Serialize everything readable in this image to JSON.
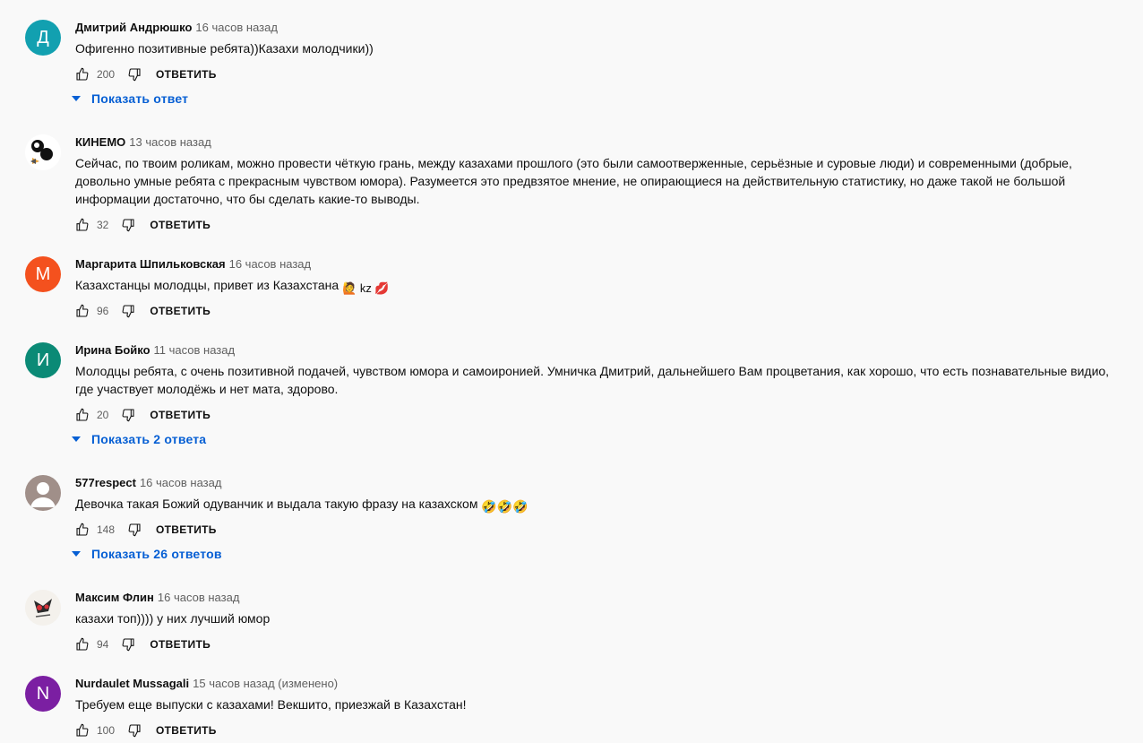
{
  "comments": [
    {
      "avatar_letter": "Д",
      "avatar_color": "#12a0b0",
      "author": "Дмитрий Андрюшко",
      "time": "16 часов назад",
      "text": "Офигенно позитивные ребята))Казахи молодчики))",
      "likes": "200",
      "reply_label": "ОТВЕТИТЬ",
      "replies_label": "Показать ответ"
    },
    {
      "avatar_letter": "",
      "avatar_color": "#ffffff",
      "author": "КИНЕМО",
      "time": "13 часов назад",
      "text": "Сейчас, по твоим роликам, можно провести чёткую грань, между казахами прошлого (это были самоотверженные, серьёзные и суровые люди) и современными (добрые, довольно умные ребята с прекрасным чувством юмора). Разумеется это предвзятое мнение, не опирающиеся на действительную статистику, но даже такой не большой информации достаточно, что бы сделать какие-то выводы.",
      "likes": "32",
      "reply_label": "ОТВЕТИТЬ"
    },
    {
      "avatar_letter": "М",
      "avatar_color": "#f4511e",
      "author": "Маргарита Шпильковская",
      "time": "16 часов назад",
      "text": "Казахстанцы молодцы, привет из Казахстана",
      "emoji_suffix": "🙋 kz 💋",
      "likes": "96",
      "reply_label": "ОТВЕТИТЬ"
    },
    {
      "avatar_letter": "И",
      "avatar_color": "#0b8a76",
      "author": "Ирина Бойко",
      "time": "11 часов назад",
      "text": "Молодцы ребята, с очень позитивной подачей, чувством юмора и самоиронией. Умничка Дмитрий, дальнейшего Вам процветания, как хорошо, что есть познавательные видио, где участвует молодёжь и нет мата, здорово.",
      "likes": "20",
      "reply_label": "ОТВЕТИТЬ",
      "replies_label": "Показать 2 ответа"
    },
    {
      "avatar_letter": "",
      "avatar_color": "#a08f89",
      "author": "577respect",
      "time": "16 часов назад",
      "text": "Девочка такая Божий одуванчик и выдала такую фразу на казахском",
      "emoji_suffix": "🤣🤣🤣",
      "likes": "148",
      "reply_label": "ОТВЕТИТЬ",
      "replies_label": "Показать 26 ответов"
    },
    {
      "avatar_letter": "",
      "avatar_color": "#f4f1ec",
      "author": "Максим Флин",
      "time": "16 часов назад",
      "text": "казахи топ)))) у них лучший юмор",
      "likes": "94",
      "reply_label": "ОТВЕТИТЬ"
    },
    {
      "avatar_letter": "N",
      "avatar_color": "#7b1fa2",
      "author": "Nurdaulet Mussagali",
      "time": "15 часов назад (изменено)",
      "text": "Требуем еще выпуски с казахами! Векшито, приезжай в Казахстан!",
      "likes": "100",
      "reply_label": "ОТВЕТИТЬ"
    }
  ],
  "icons": {
    "like": "thumbs-up-icon",
    "dislike": "thumbs-down-icon",
    "expand": "caret-down-icon"
  }
}
